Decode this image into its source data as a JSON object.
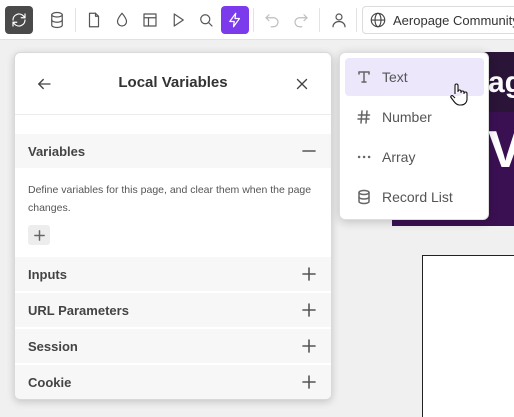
{
  "toolbar": {
    "buttons": [
      "sync-icon",
      "database-icon",
      "page-icon",
      "droplet-icon",
      "layout-icon",
      "play-icon",
      "search-icon",
      "lightning-icon",
      "undo-icon",
      "redo-icon",
      "user-icon"
    ],
    "active": "lightning-icon",
    "accent": "#7c3aed",
    "project_name": "Aeropage Community"
  },
  "panel": {
    "title": "Local Variables",
    "sections": [
      {
        "label": "Variables",
        "expanded": true
      },
      {
        "label": "Inputs",
        "expanded": false
      },
      {
        "label": "URL Parameters",
        "expanded": false
      },
      {
        "label": "Session",
        "expanded": false
      },
      {
        "label": "Cookie",
        "expanded": false
      }
    ],
    "variables_description": "Define variables for this page, and clear them when the page changes."
  },
  "type_menu": {
    "items": [
      {
        "label": "Text",
        "icon": "text-type-icon",
        "hovered": true
      },
      {
        "label": "Number",
        "icon": "hash-icon"
      },
      {
        "label": "Array",
        "icon": "dots-icon"
      },
      {
        "label": "Record List",
        "icon": "database-icon"
      }
    ],
    "hover_color": "#ece7fb"
  }
}
